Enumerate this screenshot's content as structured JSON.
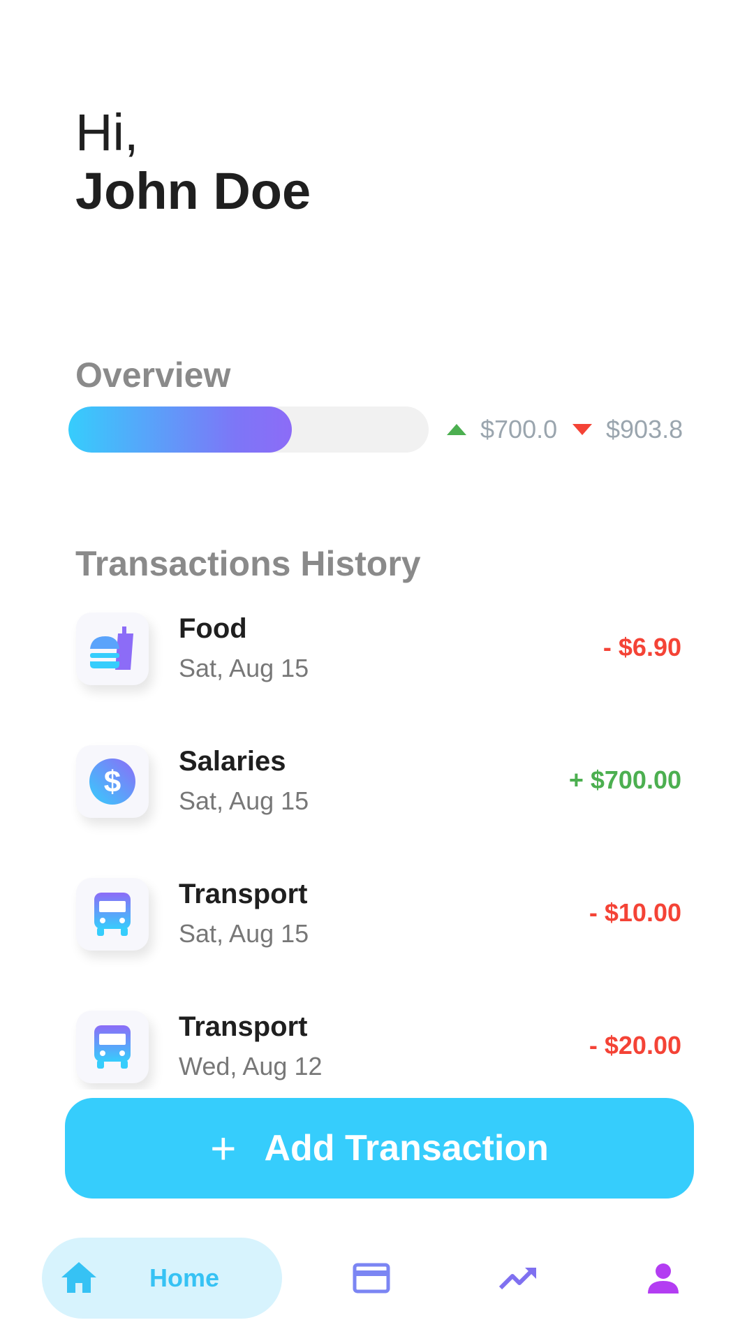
{
  "greeting": {
    "hi": "Hi,",
    "name": "John Doe"
  },
  "overview": {
    "title": "Overview",
    "progress_fraction": 0.62,
    "income_icon": "triangle-up-icon",
    "income": "$700.0",
    "expense_icon": "triangle-down-icon",
    "expense": "$903.8"
  },
  "transactions": {
    "title": "Transactions History",
    "items": [
      {
        "category": "Food",
        "date": "Sat, Aug 15",
        "amount": "- $6.90",
        "icon": "food-icon",
        "amount_color": "#f44336"
      },
      {
        "category": "Salaries",
        "date": "Sat, Aug 15",
        "amount": "+ $700.00",
        "icon": "dollar-icon",
        "amount_color": "#4caf50"
      },
      {
        "category": "Transport",
        "date": "Sat, Aug 15",
        "amount": "- $10.00",
        "icon": "bus-icon",
        "amount_color": "#f44336"
      },
      {
        "category": "Transport",
        "date": "Wed, Aug 12",
        "amount": "- $20.00",
        "icon": "bus-icon",
        "amount_color": "#f44336"
      }
    ]
  },
  "add_button": {
    "label": "Add Transaction",
    "icon": "plus-icon"
  },
  "nav": {
    "home_label": "Home",
    "items": [
      "home-icon",
      "card-icon",
      "trending-up-icon",
      "person-icon"
    ]
  },
  "colors": {
    "accent": "#36cdfc",
    "gradient_end": "#8c6cf7",
    "positive": "#4caf50",
    "negative": "#f44336",
    "profile": "#b33df2"
  }
}
